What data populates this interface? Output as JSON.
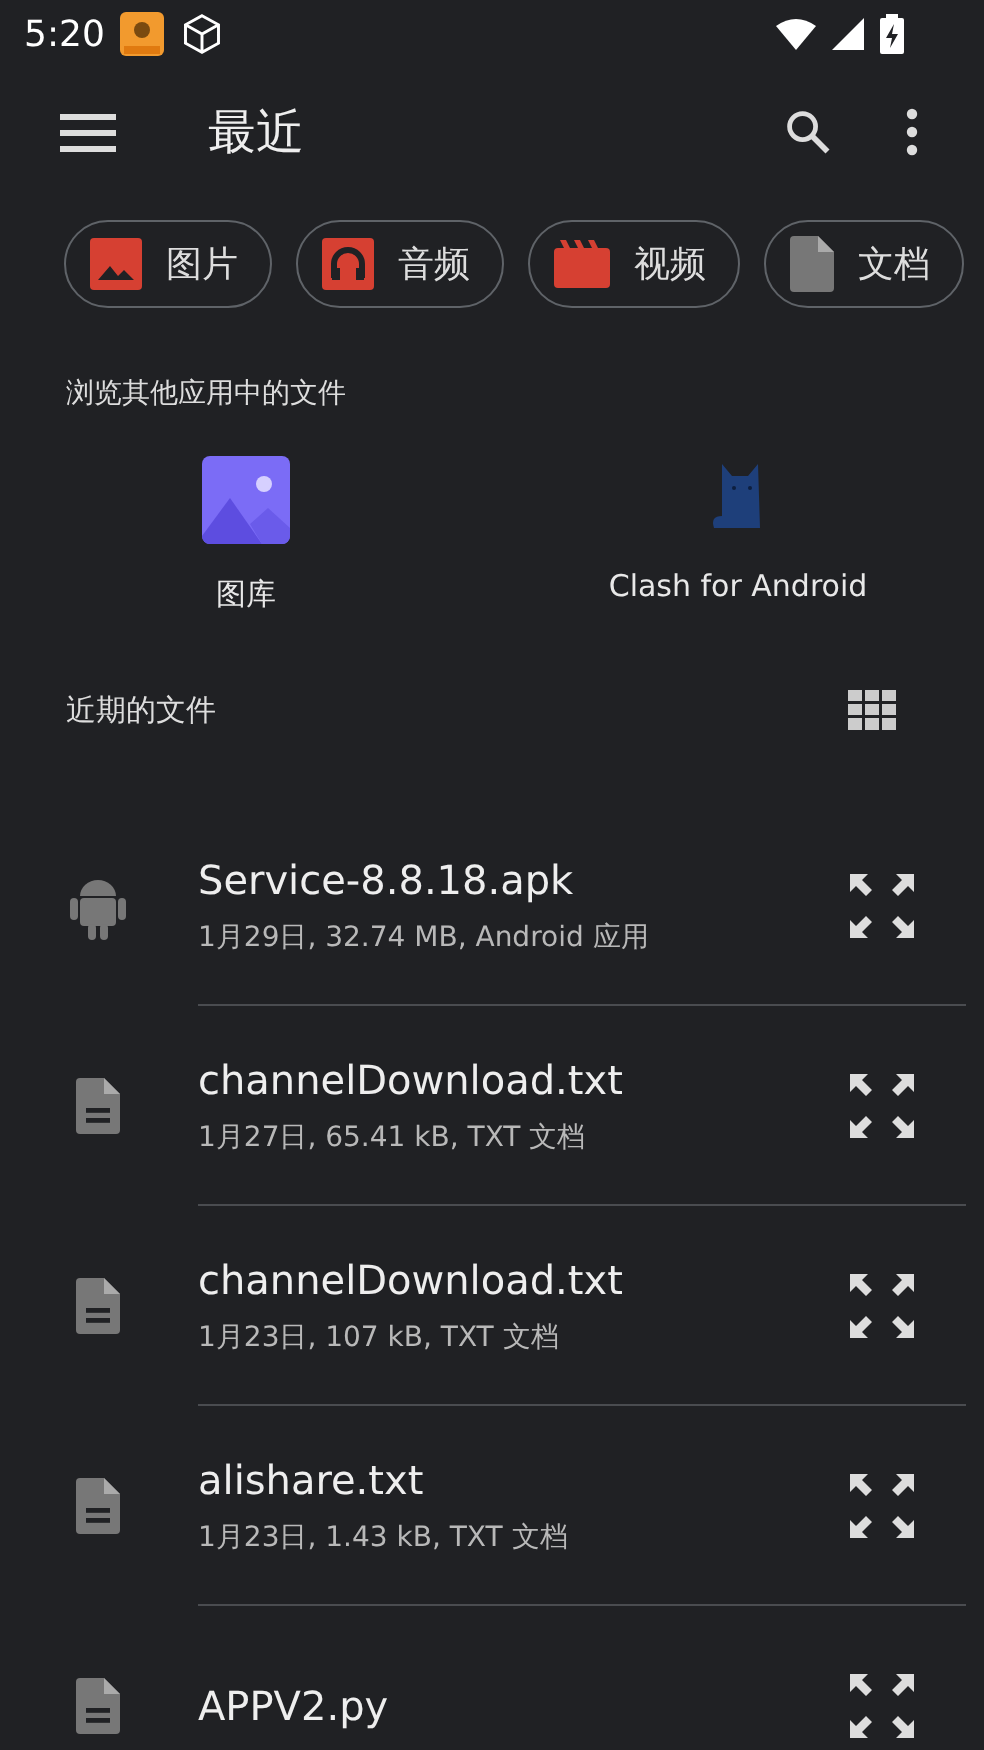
{
  "status_bar": {
    "time": "5:20"
  },
  "toolbar": {
    "title": "最近"
  },
  "chips": [
    {
      "label": "图片",
      "kind": "image"
    },
    {
      "label": "音频",
      "kind": "audio"
    },
    {
      "label": "视频",
      "kind": "video"
    },
    {
      "label": "文档",
      "kind": "document"
    }
  ],
  "other_apps": {
    "heading": "浏览其他应用中的文件",
    "apps": [
      {
        "label": "图库",
        "kind": "gallery"
      },
      {
        "label": "Clash for Android",
        "kind": "cat"
      }
    ]
  },
  "recent": {
    "heading": "近期的文件"
  },
  "files": [
    {
      "name": "Service-8.8.18.apk",
      "meta": "1月29日, 32.74 MB, Android 应用",
      "kind": "android"
    },
    {
      "name": "channelDownload.txt",
      "meta": "1月27日, 65.41 kB, TXT 文档",
      "kind": "document"
    },
    {
      "name": "channelDownload.txt",
      "meta": "1月23日, 107 kB, TXT 文档",
      "kind": "document"
    },
    {
      "name": "alishare.txt",
      "meta": "1月23日, 1.43 kB, TXT 文档",
      "kind": "document"
    },
    {
      "name": "APPV2.py",
      "kind": "document"
    }
  ]
}
